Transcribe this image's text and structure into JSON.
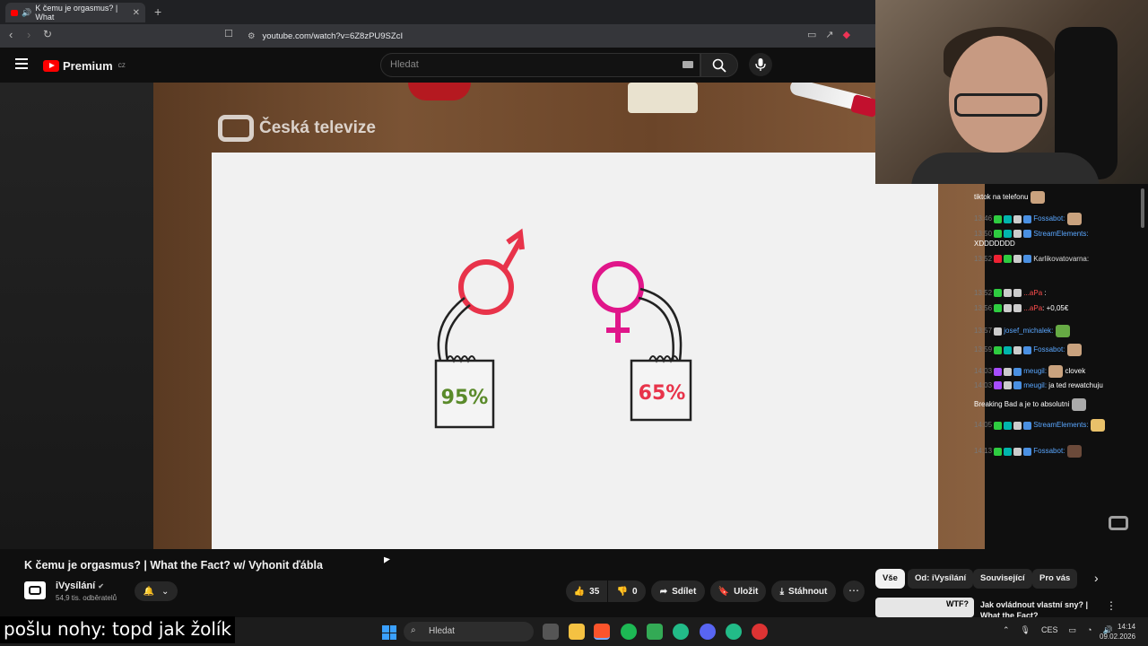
{
  "browser": {
    "tab_title": "K čemu je orgasmus? | What",
    "url": "youtube.com/watch?v=6Z8zPU9SZcI"
  },
  "youtube": {
    "logo_text": "Premium",
    "logo_region": "CZ",
    "search_placeholder": "Hledat"
  },
  "video": {
    "broadcaster": "Česká televize",
    "male_percent": "95%",
    "female_percent": "65%",
    "title": "K čemu je orgasmus? | What the Fact? w/ Vyhonit ďábla",
    "channel": "iVysílání",
    "subscribers": "54,9 tis. odběratelů",
    "likes": "35",
    "dislikes": "0",
    "share_label": "Sdílet",
    "save_label": "Uložit",
    "download_label": "Stáhnout"
  },
  "chips": [
    "Vše",
    "Od: iVysílání",
    "Související",
    "Pro vás"
  ],
  "recommendation": {
    "thumb_text": "WTF?",
    "title": "Jak ovládnout vlastní sny? | What the Fact?"
  },
  "chat": [
    {
      "time": "",
      "nick": "",
      "text": "tiktok na telefonu"
    },
    {
      "time": "13:46",
      "nick": "Fossabot:",
      "text": ""
    },
    {
      "time": "13:50",
      "nick": "StreamElements:",
      "text": "XDDDDDDD"
    },
    {
      "time": "13:52",
      "nick": "Karlikovatovarna:",
      "text": ""
    },
    {
      "time": "13:52",
      "nick": "...aPa",
      "text": ":"
    },
    {
      "time": "13:56",
      "nick": "...aPa",
      "text": ": +0,05€"
    },
    {
      "time": "13:57",
      "nick": "josef_michalek:",
      "text": ""
    },
    {
      "time": "13:59",
      "nick": "Fossabot:",
      "text": ""
    },
    {
      "time": "14:03",
      "nick": "meugil:",
      "text": "clovek"
    },
    {
      "time": "14:03",
      "nick": "meugil:",
      "text": "ja ted rewatchuju"
    },
    {
      "time": "",
      "nick": "",
      "text": "Breaking Bad a je to absolutni"
    },
    {
      "time": "14:05",
      "nick": "StreamElements:",
      "text": ""
    },
    {
      "time": "14:13",
      "nick": "Fossabot:",
      "text": ""
    }
  ],
  "subtitle_overlay": "pošlu nohy: topd jak žolík",
  "taskbar": {
    "search_placeholder": "Hledat",
    "language": "CES",
    "time": "14:14",
    "date": "09.02.2026"
  },
  "colors": {
    "male_symbol": "#e8334a",
    "female_symbol": "#e0168a",
    "male_box_text": "#5a8a2a",
    "female_box_text": "#e8334a",
    "youtube_red": "#ff0000"
  }
}
